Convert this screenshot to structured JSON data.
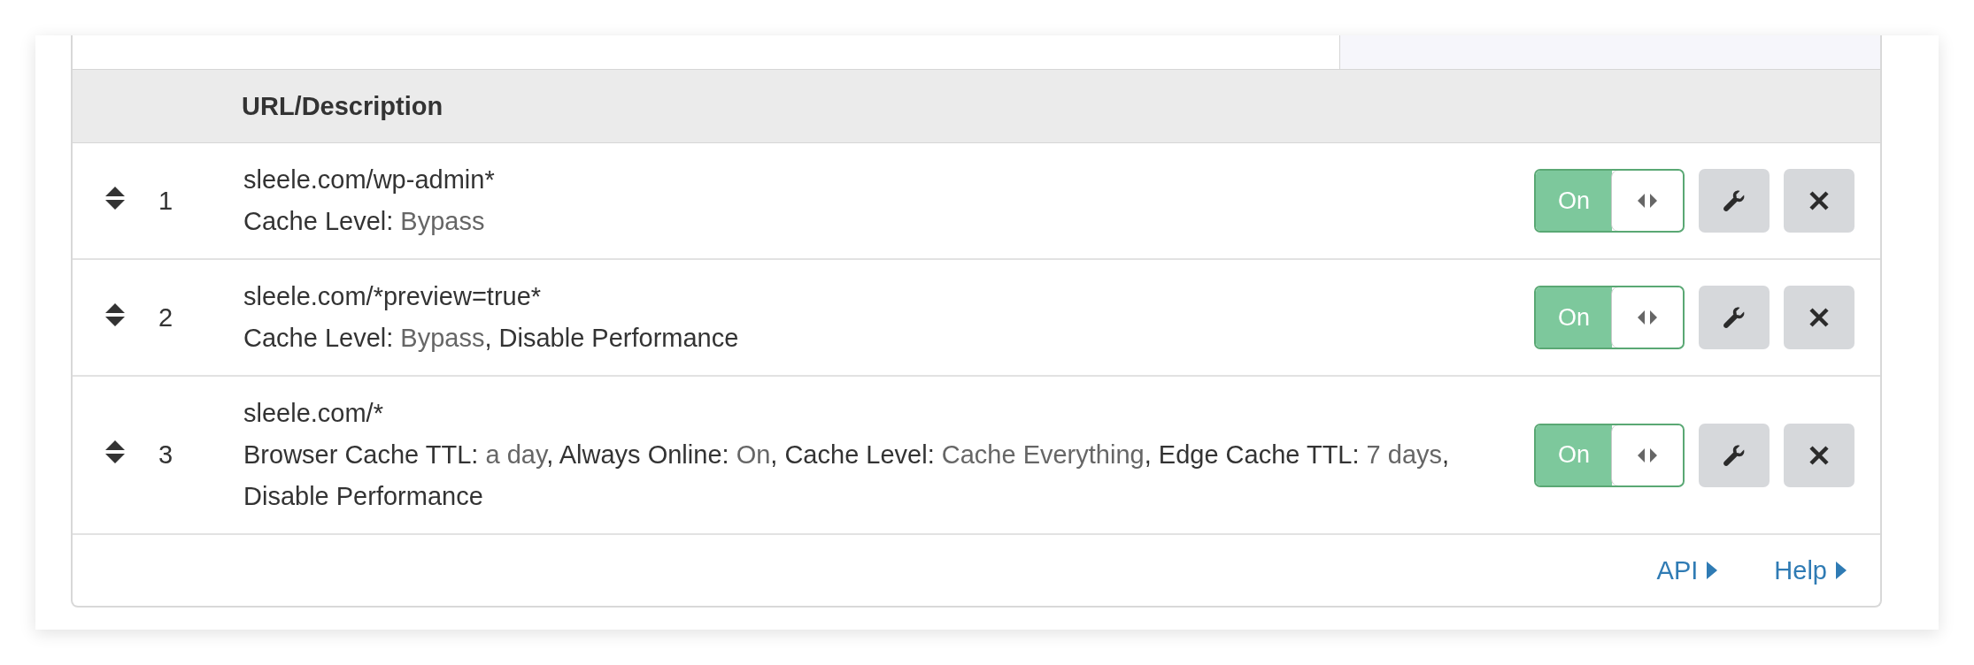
{
  "table": {
    "columns": [
      "URL/Description"
    ],
    "rows": [
      {
        "number": "1",
        "url": "sleele.com/wp-admin*",
        "description": [
          {
            "kind": "label",
            "text": "Cache Level: "
          },
          {
            "kind": "value",
            "text": "Bypass"
          }
        ],
        "toggle": {
          "label": "On",
          "on": true
        }
      },
      {
        "number": "2",
        "url": "sleele.com/*preview=true*",
        "description": [
          {
            "kind": "label",
            "text": "Cache Level: "
          },
          {
            "kind": "value",
            "text": "Bypass"
          },
          {
            "kind": "label",
            "text": ", Disable Performance"
          }
        ],
        "toggle": {
          "label": "On",
          "on": true
        }
      },
      {
        "number": "3",
        "url": "sleele.com/*",
        "description": [
          {
            "kind": "label",
            "text": "Browser Cache TTL: "
          },
          {
            "kind": "value",
            "text": "a day"
          },
          {
            "kind": "label",
            "text": ", Always Online: "
          },
          {
            "kind": "value",
            "text": "On"
          },
          {
            "kind": "label",
            "text": ", Cache Level: "
          },
          {
            "kind": "value",
            "text": "Cache Everything"
          },
          {
            "kind": "label",
            "text": ", Edge Cache TTL: "
          },
          {
            "kind": "value",
            "text": "7 days"
          },
          {
            "kind": "label",
            "text": ", Disable Performance"
          }
        ],
        "toggle": {
          "label": "On",
          "on": true
        }
      }
    ]
  },
  "footer": {
    "links": [
      "API",
      "Help"
    ]
  }
}
